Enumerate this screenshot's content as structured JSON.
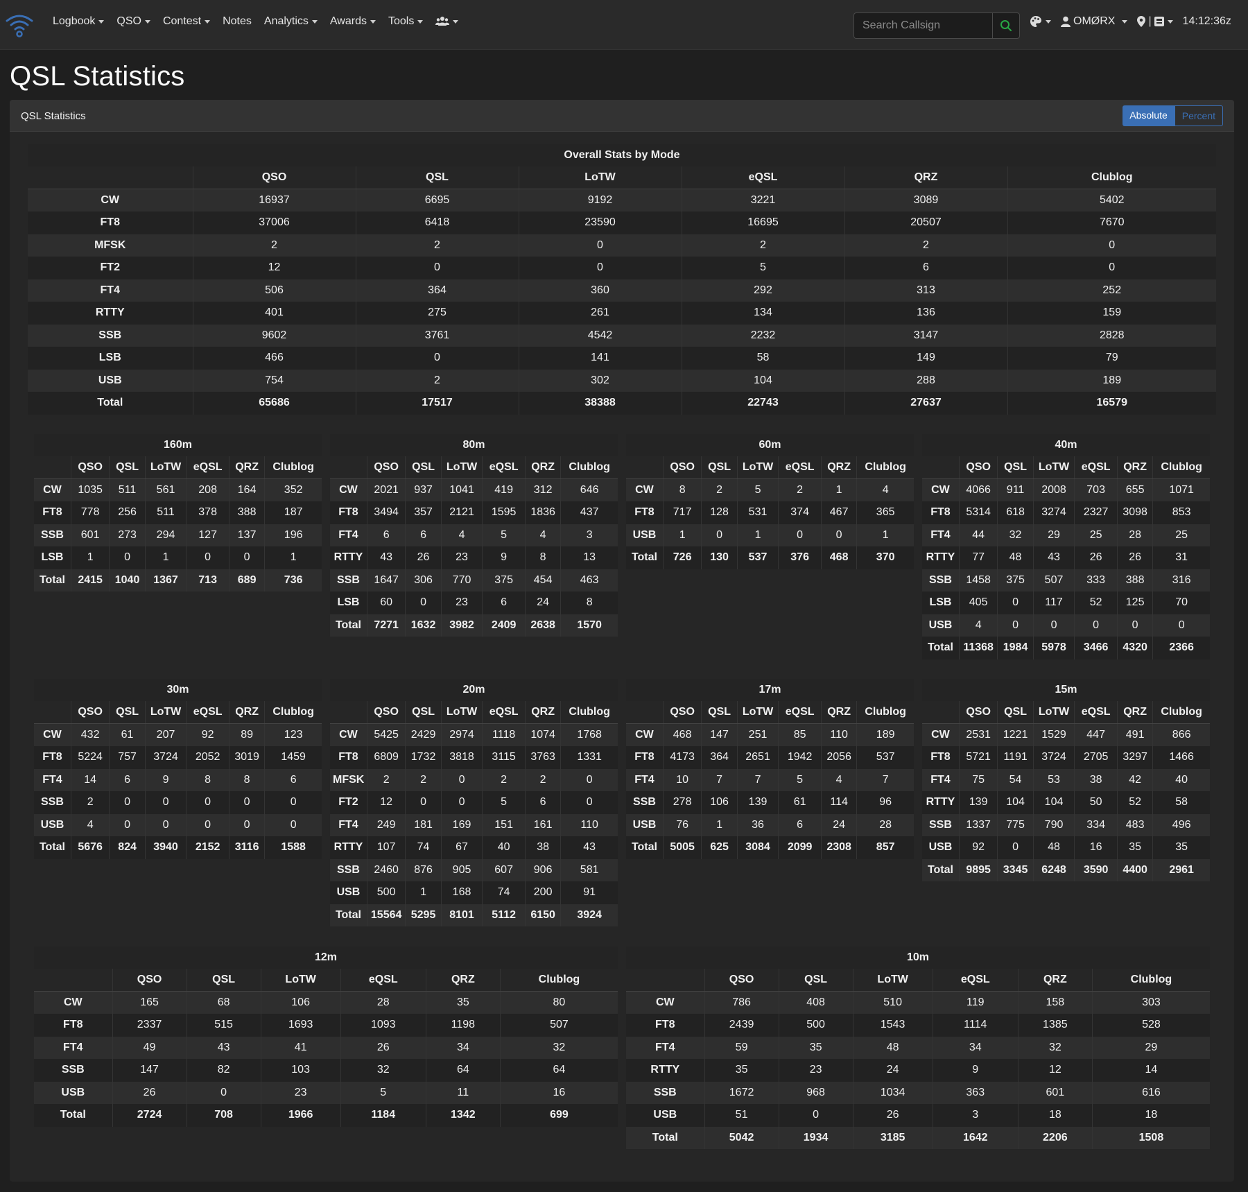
{
  "nav": {
    "items": [
      {
        "label": "Logbook",
        "dropdown": true
      },
      {
        "label": "QSO",
        "dropdown": true
      },
      {
        "label": "Contest",
        "dropdown": true
      },
      {
        "label": "Notes",
        "dropdown": false
      },
      {
        "label": "Analytics",
        "dropdown": true
      },
      {
        "label": "Awards",
        "dropdown": true
      },
      {
        "label": "Tools",
        "dropdown": true
      }
    ],
    "search_placeholder": "Search Callsign",
    "user_label": "OMØRX",
    "clock": "14:12:36z"
  },
  "page": {
    "title": "QSL Statistics",
    "card_title": "QSL Statistics",
    "toggle_absolute": "Absolute",
    "toggle_percent": "Percent"
  },
  "colors": {
    "accent": "#3a6fb5",
    "search_icon": "#28a745"
  },
  "overall": {
    "title": "Overall Stats by Mode",
    "columns": [
      "QSO",
      "QSL",
      "LoTW",
      "eQSL",
      "QRZ",
      "Clublog"
    ],
    "rows": [
      {
        "mode": "CW",
        "values": [
          "16937",
          "6695",
          "9192",
          "3221",
          "3089",
          "5402"
        ]
      },
      {
        "mode": "FT8",
        "values": [
          "37006",
          "6418",
          "23590",
          "16695",
          "20507",
          "7670"
        ]
      },
      {
        "mode": "MFSK",
        "values": [
          "2",
          "2",
          "0",
          "2",
          "2",
          "0"
        ]
      },
      {
        "mode": "FT2",
        "values": [
          "12",
          "0",
          "0",
          "5",
          "6",
          "0"
        ]
      },
      {
        "mode": "FT4",
        "values": [
          "506",
          "364",
          "360",
          "292",
          "313",
          "252"
        ]
      },
      {
        "mode": "RTTY",
        "values": [
          "401",
          "275",
          "261",
          "134",
          "136",
          "159"
        ]
      },
      {
        "mode": "SSB",
        "values": [
          "9602",
          "3761",
          "4542",
          "2232",
          "3147",
          "2828"
        ]
      },
      {
        "mode": "LSB",
        "values": [
          "466",
          "0",
          "141",
          "58",
          "149",
          "79"
        ]
      },
      {
        "mode": "USB",
        "values": [
          "754",
          "2",
          "302",
          "104",
          "288",
          "189"
        ]
      },
      {
        "mode": "Total",
        "values": [
          "65686",
          "17517",
          "38388",
          "22743",
          "27637",
          "16579"
        ]
      }
    ]
  },
  "bands": [
    {
      "band": "160m",
      "rows": [
        {
          "mode": "CW",
          "values": [
            "1035",
            "511",
            "561",
            "208",
            "164",
            "352"
          ]
        },
        {
          "mode": "FT8",
          "values": [
            "778",
            "256",
            "511",
            "378",
            "388",
            "187"
          ]
        },
        {
          "mode": "SSB",
          "values": [
            "601",
            "273",
            "294",
            "127",
            "137",
            "196"
          ]
        },
        {
          "mode": "LSB",
          "values": [
            "1",
            "0",
            "1",
            "0",
            "0",
            "1"
          ]
        },
        {
          "mode": "Total",
          "values": [
            "2415",
            "1040",
            "1367",
            "713",
            "689",
            "736"
          ]
        }
      ]
    },
    {
      "band": "80m",
      "rows": [
        {
          "mode": "CW",
          "values": [
            "2021",
            "937",
            "1041",
            "419",
            "312",
            "646"
          ]
        },
        {
          "mode": "FT8",
          "values": [
            "3494",
            "357",
            "2121",
            "1595",
            "1836",
            "437"
          ]
        },
        {
          "mode": "FT4",
          "values": [
            "6",
            "6",
            "4",
            "5",
            "4",
            "3"
          ]
        },
        {
          "mode": "RTTY",
          "values": [
            "43",
            "26",
            "23",
            "9",
            "8",
            "13"
          ]
        },
        {
          "mode": "SSB",
          "values": [
            "1647",
            "306",
            "770",
            "375",
            "454",
            "463"
          ]
        },
        {
          "mode": "LSB",
          "values": [
            "60",
            "0",
            "23",
            "6",
            "24",
            "8"
          ]
        },
        {
          "mode": "Total",
          "values": [
            "7271",
            "1632",
            "3982",
            "2409",
            "2638",
            "1570"
          ]
        }
      ]
    },
    {
      "band": "60m",
      "rows": [
        {
          "mode": "CW",
          "values": [
            "8",
            "2",
            "5",
            "2",
            "1",
            "4"
          ]
        },
        {
          "mode": "FT8",
          "values": [
            "717",
            "128",
            "531",
            "374",
            "467",
            "365"
          ]
        },
        {
          "mode": "USB",
          "values": [
            "1",
            "0",
            "1",
            "0",
            "0",
            "1"
          ]
        },
        {
          "mode": "Total",
          "values": [
            "726",
            "130",
            "537",
            "376",
            "468",
            "370"
          ]
        }
      ]
    },
    {
      "band": "40m",
      "rows": [
        {
          "mode": "CW",
          "values": [
            "4066",
            "911",
            "2008",
            "703",
            "655",
            "1071"
          ]
        },
        {
          "mode": "FT8",
          "values": [
            "5314",
            "618",
            "3274",
            "2327",
            "3098",
            "853"
          ]
        },
        {
          "mode": "FT4",
          "values": [
            "44",
            "32",
            "29",
            "25",
            "28",
            "25"
          ]
        },
        {
          "mode": "RTTY",
          "values": [
            "77",
            "48",
            "43",
            "26",
            "26",
            "31"
          ]
        },
        {
          "mode": "SSB",
          "values": [
            "1458",
            "375",
            "507",
            "333",
            "388",
            "316"
          ]
        },
        {
          "mode": "LSB",
          "values": [
            "405",
            "0",
            "117",
            "52",
            "125",
            "70"
          ]
        },
        {
          "mode": "USB",
          "values": [
            "4",
            "0",
            "0",
            "0",
            "0",
            "0"
          ]
        },
        {
          "mode": "Total",
          "values": [
            "11368",
            "1984",
            "5978",
            "3466",
            "4320",
            "2366"
          ]
        }
      ]
    },
    {
      "band": "30m",
      "rows": [
        {
          "mode": "CW",
          "values": [
            "432",
            "61",
            "207",
            "92",
            "89",
            "123"
          ]
        },
        {
          "mode": "FT8",
          "values": [
            "5224",
            "757",
            "3724",
            "2052",
            "3019",
            "1459"
          ]
        },
        {
          "mode": "FT4",
          "values": [
            "14",
            "6",
            "9",
            "8",
            "8",
            "6"
          ]
        },
        {
          "mode": "SSB",
          "values": [
            "2",
            "0",
            "0",
            "0",
            "0",
            "0"
          ]
        },
        {
          "mode": "USB",
          "values": [
            "4",
            "0",
            "0",
            "0",
            "0",
            "0"
          ]
        },
        {
          "mode": "Total",
          "values": [
            "5676",
            "824",
            "3940",
            "2152",
            "3116",
            "1588"
          ]
        }
      ]
    },
    {
      "band": "20m",
      "rows": [
        {
          "mode": "CW",
          "values": [
            "5425",
            "2429",
            "2974",
            "1118",
            "1074",
            "1768"
          ]
        },
        {
          "mode": "FT8",
          "values": [
            "6809",
            "1732",
            "3818",
            "3115",
            "3763",
            "1331"
          ]
        },
        {
          "mode": "MFSK",
          "values": [
            "2",
            "2",
            "0",
            "2",
            "2",
            "0"
          ]
        },
        {
          "mode": "FT2",
          "values": [
            "12",
            "0",
            "0",
            "5",
            "6",
            "0"
          ]
        },
        {
          "mode": "FT4",
          "values": [
            "249",
            "181",
            "169",
            "151",
            "161",
            "110"
          ]
        },
        {
          "mode": "RTTY",
          "values": [
            "107",
            "74",
            "67",
            "40",
            "38",
            "43"
          ]
        },
        {
          "mode": "SSB",
          "values": [
            "2460",
            "876",
            "905",
            "607",
            "906",
            "581"
          ]
        },
        {
          "mode": "USB",
          "values": [
            "500",
            "1",
            "168",
            "74",
            "200",
            "91"
          ]
        },
        {
          "mode": "Total",
          "values": [
            "15564",
            "5295",
            "8101",
            "5112",
            "6150",
            "3924"
          ]
        }
      ]
    },
    {
      "band": "17m",
      "rows": [
        {
          "mode": "CW",
          "values": [
            "468",
            "147",
            "251",
            "85",
            "110",
            "189"
          ]
        },
        {
          "mode": "FT8",
          "values": [
            "4173",
            "364",
            "2651",
            "1942",
            "2056",
            "537"
          ]
        },
        {
          "mode": "FT4",
          "values": [
            "10",
            "7",
            "7",
            "5",
            "4",
            "7"
          ]
        },
        {
          "mode": "SSB",
          "values": [
            "278",
            "106",
            "139",
            "61",
            "114",
            "96"
          ]
        },
        {
          "mode": "USB",
          "values": [
            "76",
            "1",
            "36",
            "6",
            "24",
            "28"
          ]
        },
        {
          "mode": "Total",
          "values": [
            "5005",
            "625",
            "3084",
            "2099",
            "2308",
            "857"
          ]
        }
      ]
    },
    {
      "band": "15m",
      "rows": [
        {
          "mode": "CW",
          "values": [
            "2531",
            "1221",
            "1529",
            "447",
            "491",
            "866"
          ]
        },
        {
          "mode": "FT8",
          "values": [
            "5721",
            "1191",
            "3724",
            "2705",
            "3297",
            "1466"
          ]
        },
        {
          "mode": "FT4",
          "values": [
            "75",
            "54",
            "53",
            "38",
            "42",
            "40"
          ]
        },
        {
          "mode": "RTTY",
          "values": [
            "139",
            "104",
            "104",
            "50",
            "52",
            "58"
          ]
        },
        {
          "mode": "SSB",
          "values": [
            "1337",
            "775",
            "790",
            "334",
            "483",
            "496"
          ]
        },
        {
          "mode": "USB",
          "values": [
            "92",
            "0",
            "48",
            "16",
            "35",
            "35"
          ]
        },
        {
          "mode": "Total",
          "values": [
            "9895",
            "3345",
            "6248",
            "3590",
            "4400",
            "2961"
          ]
        }
      ]
    },
    {
      "band": "12m",
      "rows": [
        {
          "mode": "CW",
          "values": [
            "165",
            "68",
            "106",
            "28",
            "35",
            "80"
          ]
        },
        {
          "mode": "FT8",
          "values": [
            "2337",
            "515",
            "1693",
            "1093",
            "1198",
            "507"
          ]
        },
        {
          "mode": "FT4",
          "values": [
            "49",
            "43",
            "41",
            "26",
            "34",
            "32"
          ]
        },
        {
          "mode": "SSB",
          "values": [
            "147",
            "82",
            "103",
            "32",
            "64",
            "64"
          ]
        },
        {
          "mode": "USB",
          "values": [
            "26",
            "0",
            "23",
            "5",
            "11",
            "16"
          ]
        },
        {
          "mode": "Total",
          "values": [
            "2724",
            "708",
            "1966",
            "1184",
            "1342",
            "699"
          ]
        }
      ]
    },
    {
      "band": "10m",
      "rows": [
        {
          "mode": "CW",
          "values": [
            "786",
            "408",
            "510",
            "119",
            "158",
            "303"
          ]
        },
        {
          "mode": "FT8",
          "values": [
            "2439",
            "500",
            "1543",
            "1114",
            "1385",
            "528"
          ]
        },
        {
          "mode": "FT4",
          "values": [
            "59",
            "35",
            "48",
            "34",
            "32",
            "29"
          ]
        },
        {
          "mode": "RTTY",
          "values": [
            "35",
            "23",
            "24",
            "9",
            "12",
            "14"
          ]
        },
        {
          "mode": "SSB",
          "values": [
            "1672",
            "968",
            "1034",
            "363",
            "601",
            "616"
          ]
        },
        {
          "mode": "USB",
          "values": [
            "51",
            "0",
            "26",
            "3",
            "18",
            "18"
          ]
        },
        {
          "mode": "Total",
          "values": [
            "5042",
            "1934",
            "3185",
            "1642",
            "2206",
            "1508"
          ]
        }
      ]
    }
  ]
}
